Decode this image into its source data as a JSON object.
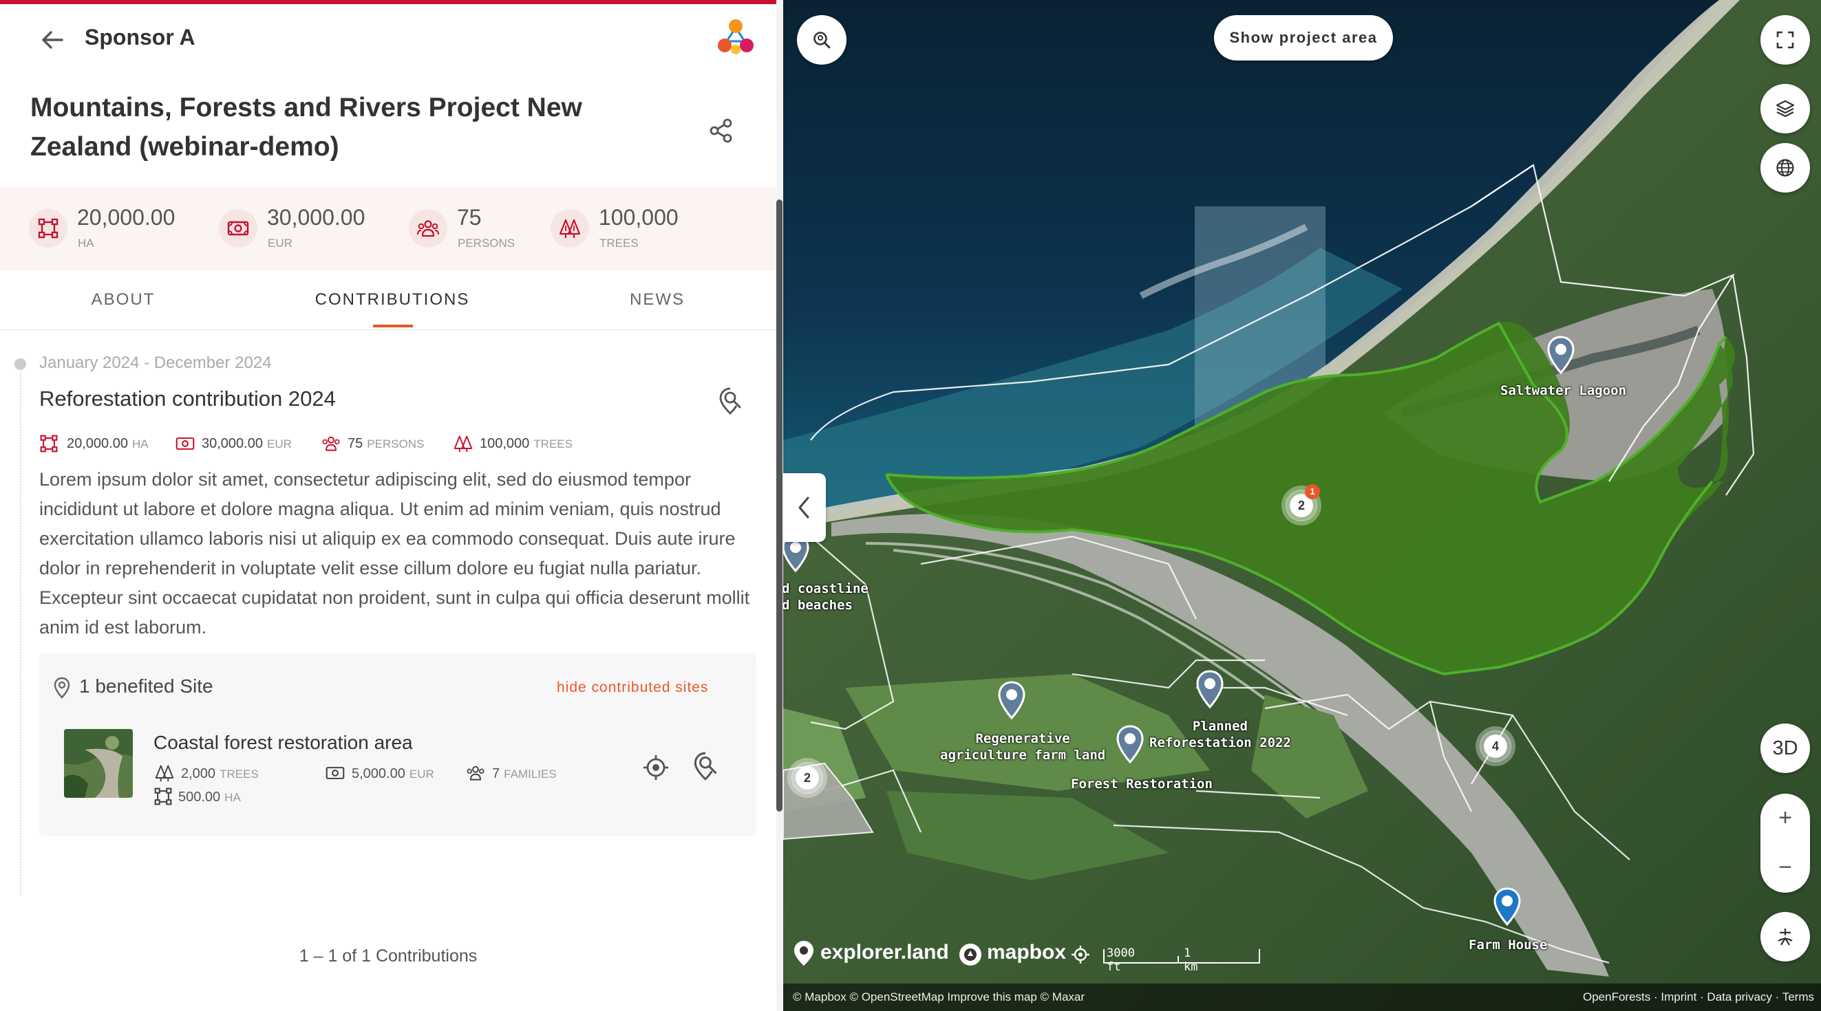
{
  "header": {
    "sponsor_name": "Sponsor A",
    "project_title": "Mountains, Forests and Rivers Project New Zealand (webinar-demo)"
  },
  "stats": [
    {
      "value": "20,000.00",
      "unit": "HA",
      "icon": "area-icon"
    },
    {
      "value": "30,000.00",
      "unit": "EUR",
      "icon": "money-icon"
    },
    {
      "value": "75",
      "unit": "PERSONS",
      "icon": "persons-icon"
    },
    {
      "value": "100,000",
      "unit": "TREES",
      "icon": "trees-icon"
    }
  ],
  "tabs": [
    {
      "label": "ABOUT",
      "active": false
    },
    {
      "label": "CONTRIBUTIONS",
      "active": true
    },
    {
      "label": "NEWS",
      "active": false
    }
  ],
  "contribution": {
    "period": "January 2024 - December 2024",
    "title": "Reforestation contribution 2024",
    "stats": [
      {
        "value": "20,000.00",
        "unit": "HA"
      },
      {
        "value": "30,000.00",
        "unit": "EUR"
      },
      {
        "value": "75",
        "unit": "PERSONS"
      },
      {
        "value": "100,000",
        "unit": "TREES"
      }
    ],
    "description": "Lorem ipsum dolor sit amet, consectetur adipiscing elit, sed do eiusmod tempor incididunt ut labore et dolore magna aliqua. Ut enim ad minim veniam, quis nostrud exercitation ullamco laboris nisi ut aliquip ex ea commodo consequat. Duis aute irure dolor in reprehenderit in voluptate velit esse cillum dolore eu fugiat nulla pariatur. Excepteur sint occaecat cupidatat non proident, sunt in culpa qui officia deserunt mollit anim id est laborum.",
    "sites": {
      "count_label": "1 benefited Site",
      "hide_label": "hide contributed sites",
      "items": [
        {
          "name": "Coastal forest restoration area",
          "trees": {
            "value": "2,000",
            "unit": "TREES"
          },
          "money": {
            "value": "5,000.00",
            "unit": "EUR"
          },
          "families": {
            "value": "7",
            "unit": "FAMILIES"
          },
          "area": {
            "value": "500.00",
            "unit": "HA"
          }
        }
      ]
    }
  },
  "paginator": "1 – 1 of 1 Contributions",
  "map": {
    "show_area_label": "Show project area",
    "three_d_label": "3D",
    "zoom_in": "+",
    "zoom_out": "−",
    "labels": {
      "saltwater": "Saltwater Lagoon",
      "coastline": "d coastline\nd beaches",
      "regen": "Regenerative\nagriculture farm land",
      "planned": "Planned\nReforestation 2022",
      "forest_rest": "Forest Restoration",
      "farm_house": "Farm House"
    },
    "clusters": {
      "main": "2",
      "main_badge": "1",
      "east": "4",
      "west": "2"
    },
    "brand_explorer": "explorer.land",
    "brand_mapbox": "mapbox",
    "scale_ft": "3000 ft",
    "scale_km": "1 km",
    "attribution_left": "© Mapbox © OpenStreetMap Improve this map © Maxar",
    "attribution_right": "OpenForests · Imprint · Data privacy · Terms"
  },
  "colors": {
    "brand_red": "#c8102e",
    "accent_orange": "#e8572a",
    "project_green": "#3f8f1e"
  }
}
